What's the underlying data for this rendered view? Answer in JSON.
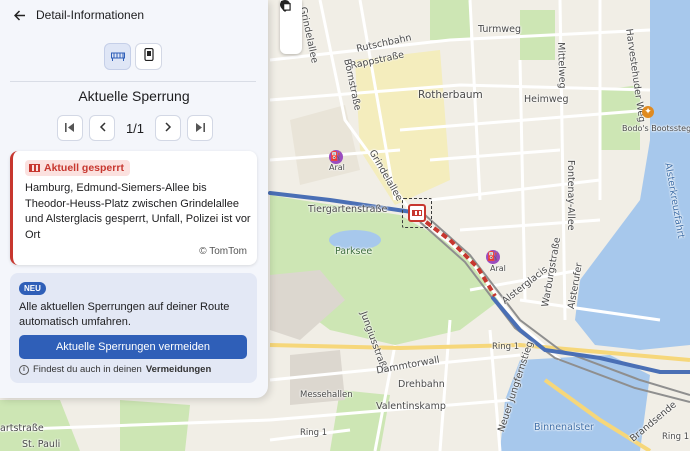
{
  "header": {
    "title": "Detail-Informationen",
    "back_icon": "arrow-left-icon"
  },
  "view_toggle": {
    "options": [
      {
        "icon": "road-closure-icon",
        "active": true
      },
      {
        "icon": "phone-icon",
        "active": false
      }
    ]
  },
  "section": {
    "title": "Aktuelle Sperrung"
  },
  "pager": {
    "count": "1/1",
    "icons": [
      "skip-first-icon",
      "chevron-left-icon",
      "chevron-right-icon",
      "skip-last-icon"
    ]
  },
  "incident": {
    "badge": "Aktuell gesperrt",
    "description": "Hamburg, Edmund-Siemers-Allee bis Theodor-Heuss-Platz zwischen Grindelallee und Alsterglacis gesperrt, Unfall, Polizei ist vor Ort",
    "source": "© TomTom",
    "accent_color": "#c7372f"
  },
  "promo": {
    "badge": "NEU",
    "text": "Alle aktuellen Sperrungen auf deiner Route automatisch umfahren.",
    "button_label": "Aktuelle Sperrungen vermeiden",
    "hint_prefix": "Findest du auch in deinen",
    "hint_bold": "Vermeidungen",
    "accent_color": "#2f5fb8"
  },
  "map": {
    "labels": {
      "rutschbahn": "Rutschbahn",
      "rappstrasse": "Rappstraße",
      "grindelallee_top": "Grindelallee",
      "bornstrasse": "Bornstraße",
      "turmweg": "Turmweg",
      "mittelweg": "Mittelweg",
      "harvestehuder": "Harvestehuder Weg",
      "rotherbaum": "Rotherbaum",
      "heimweg": "Heimweg",
      "bodos": "Bodo's Bootssteg",
      "aral_top": "Aral",
      "grindelallee_mid": "Grindelallee",
      "fontenay": "Fontenay-Allee",
      "tiergarten": "Tiergartenstraße",
      "parksee": "Parksee",
      "alsterkreuzfahrt": "Alsterkreuzfahrt",
      "aral_bottom": "Aral",
      "warburg": "Warburgstraße",
      "alsterufer": "Alsterufer",
      "jungius": "Jungiusstraße",
      "alsterglacis": "Alsterglacis",
      "ring1_mid": "Ring 1",
      "dammtorwall": "Dammtorwall",
      "drehbahn": "Drehbahn",
      "messehallen": "Messehallen",
      "valentinskamp": "Valentinskamp",
      "neuer_jungfernstieg": "Neuer Jungfernstieg",
      "binnenalster": "Binnenalster",
      "ring1_bottom": "Ring 1",
      "ring1_right": "Ring 1",
      "brandsende": "Brandsende",
      "artstrasse": "artstraße",
      "st_pauli": "St. Pauli"
    },
    "controls": [
      "layers-icon",
      "location-pin-icon",
      "copy-icon"
    ],
    "colors": {
      "water": "#a7c8ec",
      "park": "#cde6b4",
      "route": "#4a6fb5",
      "closure": "#c7372f"
    }
  }
}
